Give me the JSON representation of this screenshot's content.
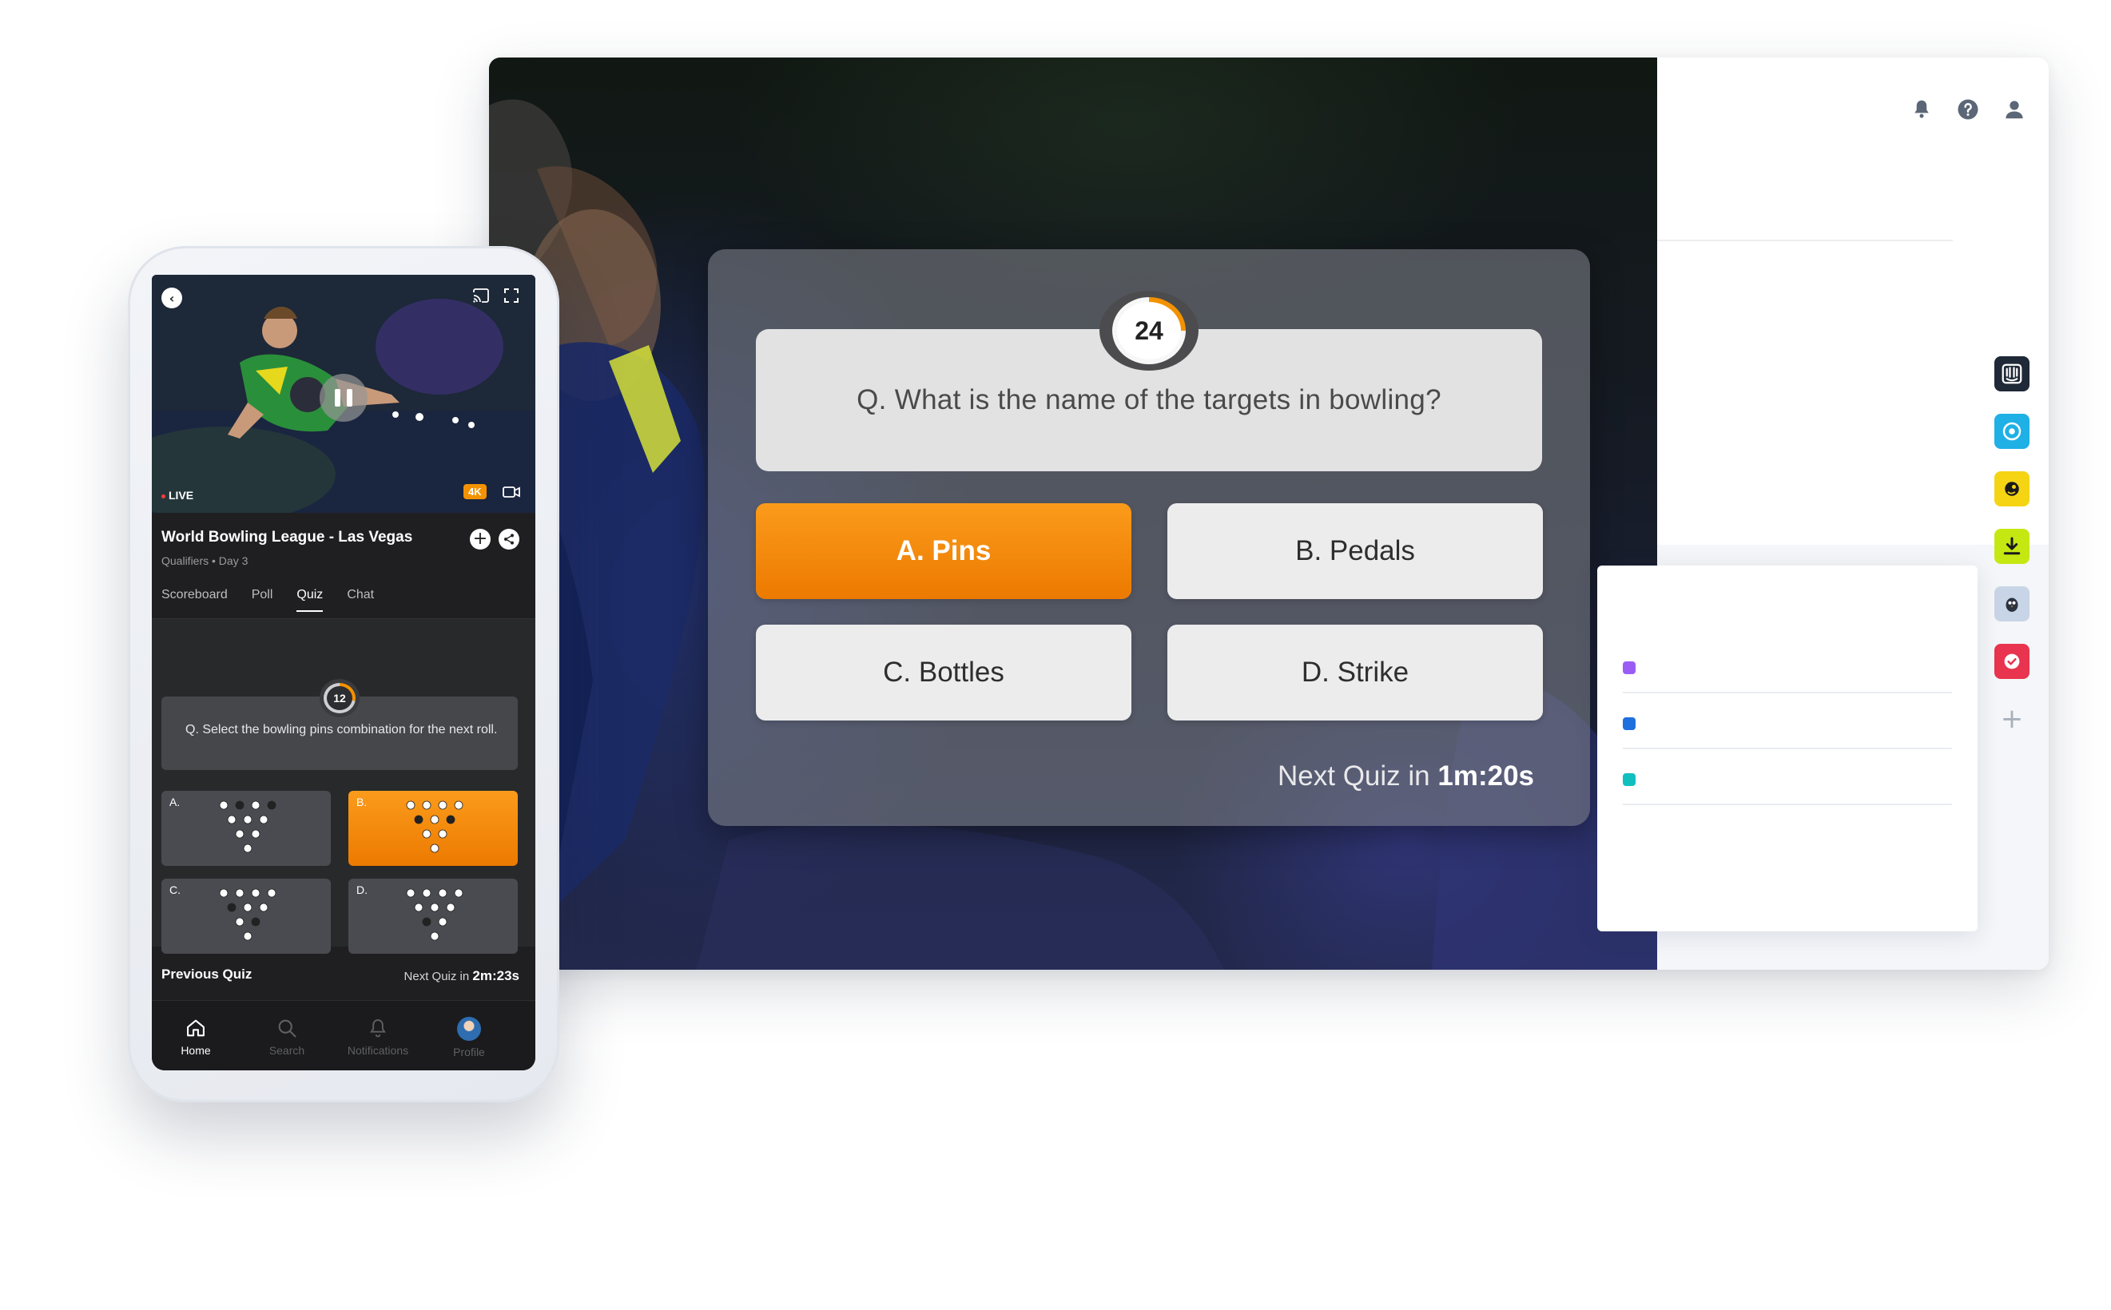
{
  "desktop": {
    "question": "Q. What is the name of the targets in bowling?",
    "timer": "24",
    "answers": [
      {
        "label": "A. Pins",
        "selected": true
      },
      {
        "label": "B. Pedals",
        "selected": false
      },
      {
        "label": "C. Bottles",
        "selected": false
      },
      {
        "label": "D. Strike",
        "selected": false
      }
    ],
    "next_quiz_prefix": "Next Quiz in",
    "next_quiz_time": "1m:20s",
    "top_icons": [
      "bell-icon",
      "help-icon",
      "user-icon"
    ],
    "apps": [
      "intercom-app-icon",
      "venmo-app-icon",
      "mailchimp-app-icon",
      "download-app-icon",
      "hootsuite-app-icon",
      "todoist-app-icon"
    ],
    "list_dot_colors": [
      "#9b5cf6",
      "#1f6fde",
      "#12bfbf"
    ]
  },
  "phone": {
    "live_label": "LIVE",
    "quality_badge": "4K",
    "title": "World Bowling League - Las Vegas",
    "subtitle": "Qualifiers • Day 3",
    "tabs": [
      "Scoreboard",
      "Poll",
      "Quiz",
      "Chat"
    ],
    "active_tab": "Quiz",
    "quiz_timer": "12",
    "quiz_question": "Q. Select the bowling pins combination for the next roll.",
    "options": [
      {
        "label": "A.",
        "selected": false
      },
      {
        "label": "B.",
        "selected": true
      },
      {
        "label": "C.",
        "selected": false
      },
      {
        "label": "D.",
        "selected": false
      }
    ],
    "previous_quiz": "Previous Quiz",
    "next_quiz_prefix": "Next Quiz in",
    "next_quiz_time": "2m:23s",
    "nav": [
      "Home",
      "Search",
      "Notifications",
      "Profile"
    ],
    "accent_color": "#f39200"
  }
}
